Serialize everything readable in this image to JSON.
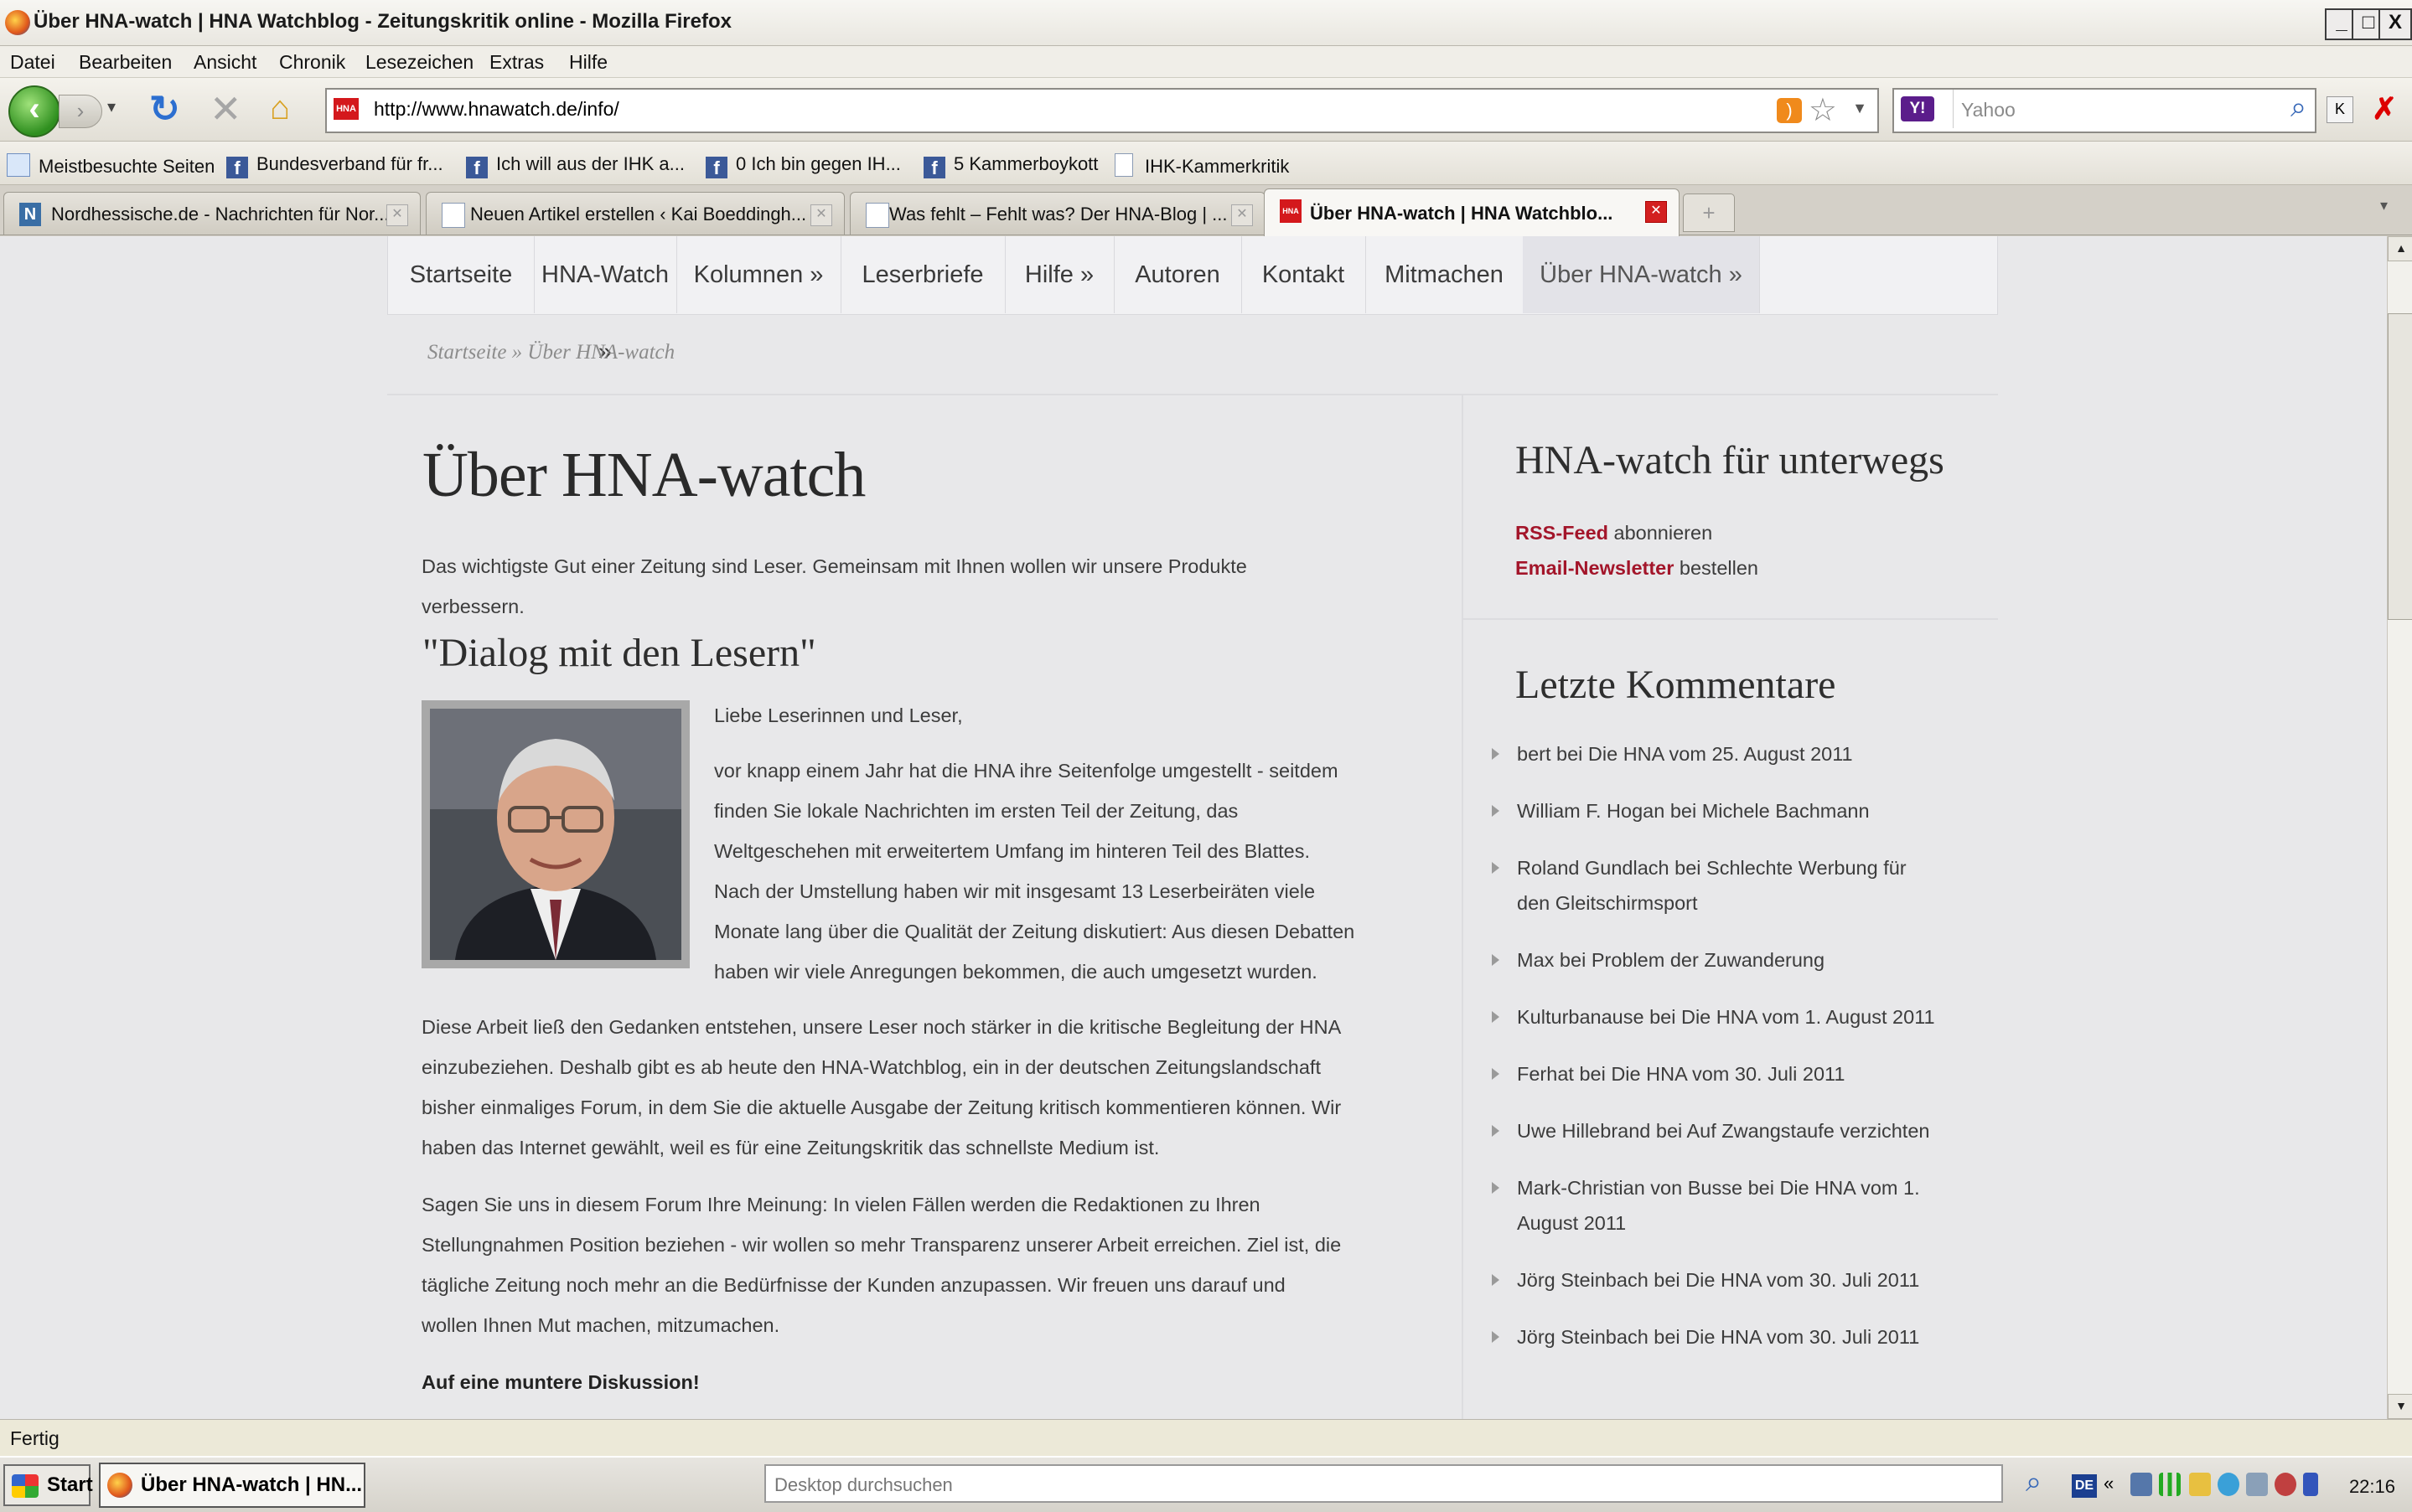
{
  "window": {
    "title": "Über HNA-watch | HNA Watchblog - Zeitungskritik online - Mozilla Firefox",
    "controls": [
      "_",
      "□",
      "X"
    ]
  },
  "menu": [
    "Datei",
    "Bearbeiten",
    "Ansicht",
    "Chronik",
    "Lesezeichen",
    "Extras",
    "Hilfe"
  ],
  "toolbar": {
    "url": "http://www.hnawatch.de/info/",
    "search_placeholder": "Yahoo",
    "favicon_text": "HNA",
    "yahoo_badge": "Y!"
  },
  "bookmarks": [
    {
      "label": "Meistbesuchte Seiten",
      "icon": "most-visited-icon"
    },
    {
      "label": "Bundesverband für fr...",
      "icon": "facebook-icon"
    },
    {
      "label": "Ich will aus der IHK a...",
      "icon": "facebook-icon"
    },
    {
      "label": "0 Ich bin gegen IH...",
      "icon": "facebook-icon"
    },
    {
      "label": "5 Kammerboykott",
      "icon": "facebook-icon"
    },
    {
      "label": "IHK-Kammerkritik",
      "icon": "page-icon"
    }
  ],
  "tabs": [
    {
      "label": "Nordhessische.de - Nachrichten für Nor...",
      "icon": "n"
    },
    {
      "label": "Neuen Artikel erstellen ‹ Kai Boeddingh...",
      "icon": "page"
    },
    {
      "label": "Was fehlt – Fehlt was? Der HNA-Blog | ...",
      "icon": "page"
    },
    {
      "label": "Über HNA-watch | HNA Watchblo...",
      "icon": "hna",
      "active": true
    }
  ],
  "site": {
    "nav": [
      "Startseite",
      "HNA-Watch »",
      "Kolumnen »",
      "Leserbriefe",
      "Hilfe »",
      "Autoren",
      "Kontakt",
      "Mitmachen",
      "Über HNA-watch »"
    ],
    "breadcrumb": "Startseite » Über HNA-watch",
    "title": "Über HNA-watch",
    "intro_line1": "Das wichtigste Gut einer Zeitung sind Leser. Gemeinsam mit Ihnen wollen wir unsere Produkte",
    "intro_line2": "verbessern.",
    "subtitle": "\"Dialog mit den Lesern\"",
    "greeting": "Liebe Leserinnen und Leser,",
    "body_side": [
      "vor knapp einem Jahr hat die HNA ihre Seitenfolge umgestellt - seitdem",
      "finden Sie lokale Nachrichten im ersten Teil der Zeitung, das",
      "Weltgeschehen mit erweitertem Umfang im hinteren Teil des Blattes.",
      "Nach der Umstellung haben wir mit insgesamt 13 Leserbeiräten viele",
      "Monate lang über die Qualität der Zeitung diskutiert: Aus diesen Debatten",
      "haben wir viele Anregungen bekommen, die auch umgesetzt wurden."
    ],
    "body_p2": [
      "Diese Arbeit ließ den Gedanken entstehen, unsere Leser noch stärker in die kritische Begleitung der HNA",
      "einzubeziehen. Deshalb gibt es ab heute den HNA-Watchblog, ein in der deutschen Zeitungslandschaft",
      "bisher einmaliges Forum, in dem Sie die aktuelle Ausgabe der Zeitung kritisch kommentieren können. Wir",
      "haben das Internet gewählt, weil es für eine Zeitungskritik das schnellste Medium ist."
    ],
    "body_p3": [
      "Sagen Sie uns in diesem Forum Ihre Meinung: In vielen Fällen werden die Redaktionen zu Ihren",
      "Stellungnahmen Position beziehen - wir wollen so mehr Transparenz unserer Arbeit erreichen. Ziel ist, die",
      "tägliche Zeitung noch mehr an die Bedürfnisse der Kunden anzupassen. Wir freuen uns darauf und",
      "wollen Ihnen Mut machen, mitzumachen."
    ],
    "closing": "Auf eine muntere Diskussion!",
    "sidebar": {
      "mobile_title": "HNA-watch für unterwegs",
      "rss_link": "RSS-Feed",
      "rss_text": " abonnieren",
      "newsletter_link": "Email-Newsletter",
      "newsletter_text": " bestellen",
      "comments_title": "Letzte Kommentare",
      "comments": [
        {
          "line1": "bert bei Die HNA vom 25. August 2011",
          "line2": ""
        },
        {
          "line1": "William F. Hogan bei Michele Bachmann",
          "line2": ""
        },
        {
          "line1": "Roland Gundlach bei Schlechte Werbung für",
          "line2": "den Gleitschirmsport"
        },
        {
          "line1": "Max bei Problem der Zuwanderung",
          "line2": ""
        },
        {
          "line1": "Kulturbanause bei Die HNA vom 1. August 2011",
          "line2": ""
        },
        {
          "line1": "Ferhat bei Die HNA vom 30. Juli 2011",
          "line2": ""
        },
        {
          "line1": "Uwe Hillebrand bei Auf Zwangstaufe verzichten",
          "line2": ""
        },
        {
          "line1": "Mark-Christian von Busse bei Die HNA vom 1.",
          "line2": "August 2011"
        },
        {
          "line1": "Jörg Steinbach bei Die HNA vom 30. Juli 2011",
          "line2": ""
        },
        {
          "line1": "Jörg Steinbach bei Die HNA vom 30. Juli 2011",
          "line2": ""
        }
      ]
    }
  },
  "status": "Fertig",
  "taskbar": {
    "start": "Start",
    "window_item": "Über HNA-watch | HN...",
    "desktop_search": "Desktop durchsuchen",
    "lang": "DE",
    "clock": "22:16"
  },
  "colors": {
    "link": "#a3152a",
    "page_bg": "#e8e8ea"
  }
}
